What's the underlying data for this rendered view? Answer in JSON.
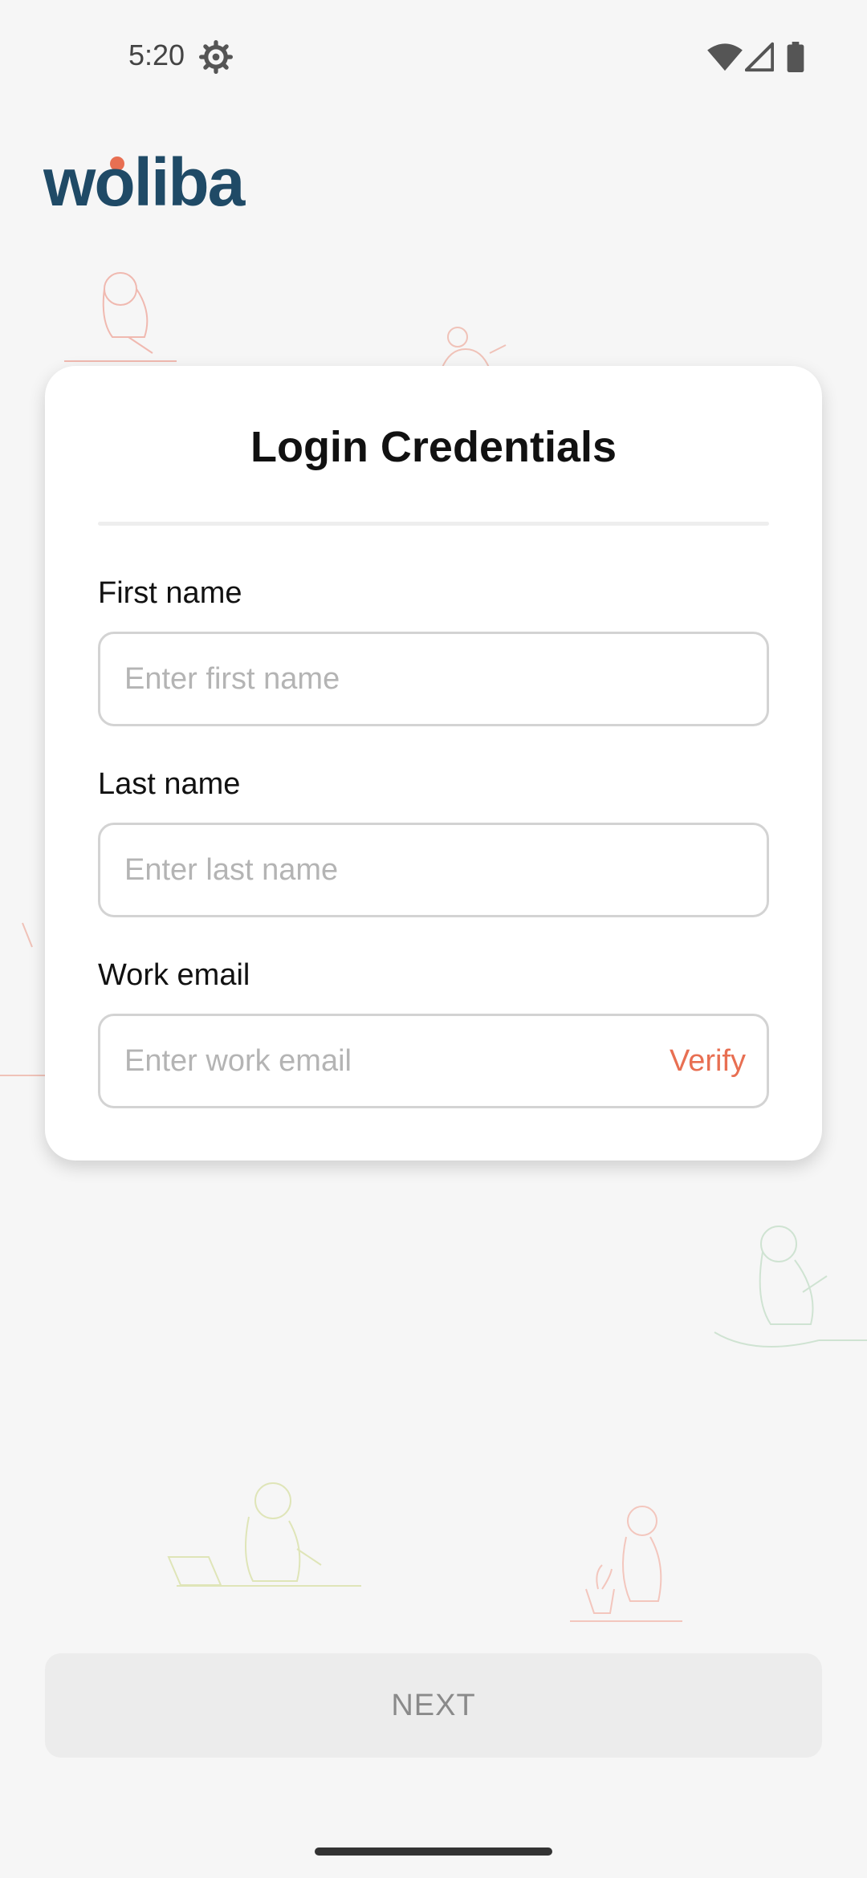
{
  "status_bar": {
    "time": "5:20",
    "icons": [
      "settings-icon",
      "wifi-icon",
      "signal-icon",
      "battery-icon"
    ]
  },
  "brand": {
    "logo_text": "woliba",
    "colors": {
      "navy": "#1f4a66",
      "accent": "#e86f52"
    }
  },
  "form": {
    "title": "Login Credentials",
    "first_name": {
      "label": "First name",
      "placeholder": "Enter first name",
      "value": ""
    },
    "last_name": {
      "label": "Last name",
      "placeholder": "Enter last name",
      "value": ""
    },
    "work_email": {
      "label": "Work email",
      "placeholder": "Enter work email",
      "value": "",
      "action": "Verify"
    }
  },
  "footer": {
    "next_label": "NEXT"
  }
}
